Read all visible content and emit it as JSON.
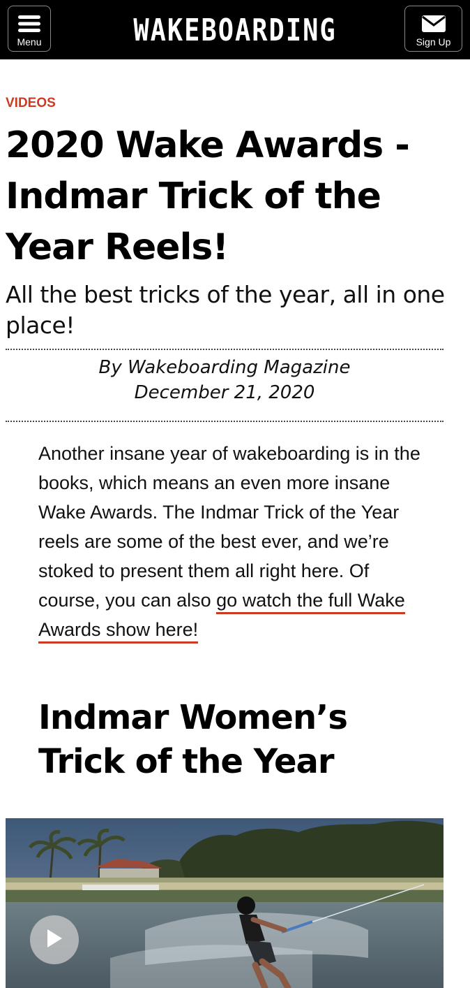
{
  "header": {
    "menu_label": "Menu",
    "menu_icon": "hamburger-icon",
    "logo": "WAKEBOARDING",
    "signup_label": "Sign Up",
    "signup_icon": "envelope-icon"
  },
  "article": {
    "category": "VIDEOS",
    "title": "2020 Wake Awards - Indmar Trick of the Year Reels!",
    "subtitle": "All the best tricks of the year, all in one place!",
    "author": "By Wakeboarding Magazine",
    "date": "December 21, 2020",
    "body_text": "Another insane year of wakeboarding is in the books, which means an even more insane Wake Awards. The Indmar Trick of the Year reels are some of the best ever, and we’re stoked to present them all right here. Of course, you can also ",
    "body_link": "go watch the full Wake Awards show here!",
    "section_title": "Indmar Women’s Trick of the Year"
  },
  "video": {
    "play_icon": "play-icon"
  },
  "colors": {
    "accent": "#cc3a21",
    "header_bg": "#000000"
  }
}
